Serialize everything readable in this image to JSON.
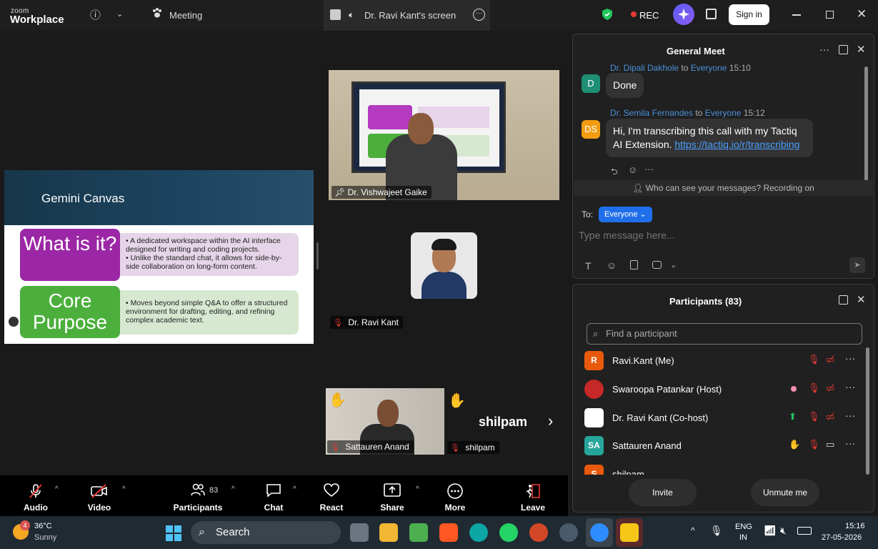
{
  "titlebar": {
    "logo_small": "zoom",
    "logo_big": "Workplace",
    "meeting_label": "Meeting",
    "screen_tab_label": "Dr. Ravi Kant's screen",
    "rec_label": "REC",
    "signin_label": "Sign in",
    "accent_color": "#1f6feb"
  },
  "slide": {
    "title": "Gemini Canvas",
    "box1_label": "What is it?",
    "box1_points": [
      "• A dedicated workspace within the AI interface designed for writing and coding projects.",
      "• Unlike the standard chat, it allows for side-by-side collaboration on long-form content."
    ],
    "box2_label": "Core Purpose",
    "box2_text": "• Moves beyond simple Q&A to offer a structured environment for drafting, editing, and refining complex academic text."
  },
  "videos": {
    "presenter_name": "Dr. Vishwajeet Gaike",
    "ravi_name": "Dr. Ravi Kant",
    "sattauren_name": "Sattauren Anand",
    "shilpam_name": "shilpam",
    "shilpam_big": "shilpam"
  },
  "toolbar": {
    "audio": "Audio",
    "video": "Video",
    "participants": "Participants",
    "participants_count": "83",
    "chat": "Chat",
    "react": "React",
    "share": "Share",
    "more": "More",
    "leave": "Leave"
  },
  "chat": {
    "title": "General Meet",
    "messages": [
      {
        "sender": "Dr. Dipali Dakhole",
        "to": "to",
        "recipient": "Everyone",
        "time": "15:10",
        "initials": "D",
        "text": "Done"
      },
      {
        "sender": "Dr. Semila Fernandes",
        "to": "to",
        "recipient": "Everyone",
        "time": "15:12",
        "initials": "DS",
        "text": "Hi, I'm transcribing this call with my Tactiq AI Extension.",
        "link": "https://tactiq.io/r/transcribing"
      }
    ],
    "notice": "Who can see your messages? Recording on",
    "to_label": "To:",
    "to_value": "Everyone",
    "placeholder": "Type message here..."
  },
  "participants": {
    "title": "Participants (83)",
    "search_placeholder": "Find a participant",
    "rows": [
      {
        "initials": "R",
        "name": "Ravi.Kant (Me)",
        "color": "#e8590c"
      },
      {
        "initials": "",
        "name": "Swaroopa Patankar (Host)",
        "color": "#c62828"
      },
      {
        "initials": "",
        "name": "Dr. Ravi Kant (Co-host)",
        "color": "#ffffff"
      },
      {
        "initials": "SA",
        "name": "Sattauren Anand",
        "color": "#26a69a"
      },
      {
        "initials": "S",
        "name": "shilpam",
        "color": "#e8590c"
      }
    ],
    "invite_label": "Invite",
    "unmute_label": "Unmute me"
  },
  "taskbar": {
    "weather_temp": "36°C",
    "weather_cond": "Sunny",
    "weather_badge": "4",
    "search_label": "Search",
    "lang1": "ENG",
    "lang2": "IN",
    "time": "15:16",
    "date": "27-05-2026"
  }
}
